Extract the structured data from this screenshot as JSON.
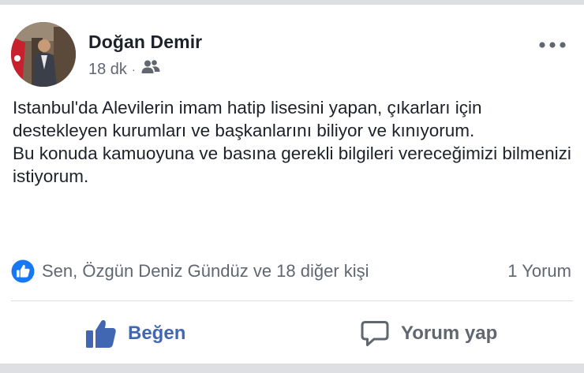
{
  "post": {
    "author": "Doğan Demir",
    "time": "18 dk",
    "separator": "·",
    "audience_icon": "friends-icon",
    "paragraphs": [
      "Istanbul'da Alevilerin imam hatip lisesini yapan, çıkarları için destekleyen kurumları ve başkanlarını biliyor ve kınıyorum.",
      "Bu konuda kamuoyuna ve basına gerekli bilgileri vereceğimizi bilmenizi istiyorum."
    ]
  },
  "reactions": {
    "summary": "Sen, Özgün Deniz Gündüz ve 18 diğer kişi",
    "comments": "1 Yorum"
  },
  "actions": {
    "like_label": "Beğen",
    "comment_label": "Yorum yap"
  },
  "colors": {
    "brand": "#4267b2",
    "text": "#1d2129",
    "secondary": "#606770",
    "like_badge": "#1877f2"
  }
}
